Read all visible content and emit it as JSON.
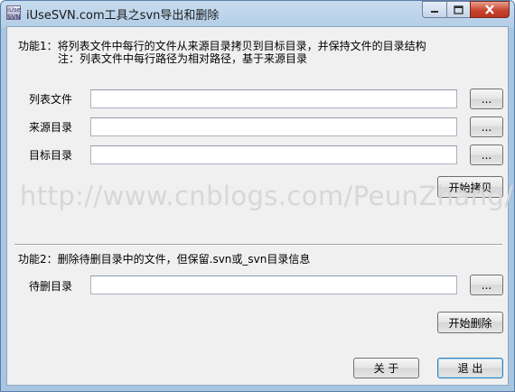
{
  "window": {
    "title": "iUseSVN.com工具之svn导出和删除",
    "icon_text": "iUse SVN",
    "controls": [
      "minimize-icon",
      "maximize-icon",
      "close-icon"
    ]
  },
  "section1": {
    "heading": "功能1：将列表文件中每行的文件从来源目录拷贝到目标目录，并保持文件的目录结构",
    "note": "注：列表文件中每行路径为相对路径，基于来源目录",
    "list_file": {
      "label": "列表文件",
      "value": "",
      "browse": "..."
    },
    "source_dir": {
      "label": "来源目录",
      "value": "",
      "browse": "..."
    },
    "target_dir": {
      "label": "目标目录",
      "value": "",
      "browse": "..."
    },
    "start_copy": "开始拷贝"
  },
  "watermark": "http://www.cnblogs.com/PeunZhang/",
  "section2": {
    "heading": "功能2：删除待删目录中的文件，但保留.svn或_svn目录信息",
    "delete_dir": {
      "label": "待删目录",
      "value": "",
      "browse": "..."
    },
    "start_delete": "开始删除"
  },
  "footer": {
    "about": "关  于",
    "exit": "退  出"
  }
}
